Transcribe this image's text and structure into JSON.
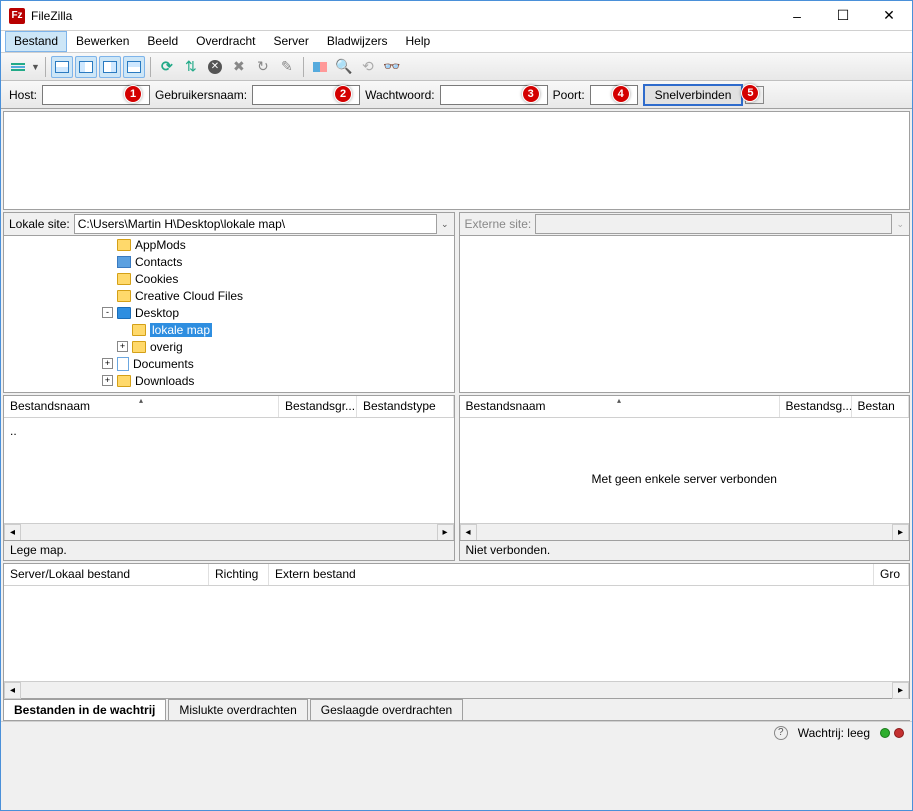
{
  "window": {
    "title": "FileZilla"
  },
  "menu": {
    "items": [
      "Bestand",
      "Bewerken",
      "Beeld",
      "Overdracht",
      "Server",
      "Bladwijzers",
      "Help"
    ]
  },
  "quick_connect": {
    "host_label": "Host:",
    "user_label": "Gebruikersnaam:",
    "pass_label": "Wachtwoord:",
    "port_label": "Poort:",
    "button_label": "Snelverbinden",
    "host_value": "",
    "user_value": "",
    "pass_value": "",
    "port_value": "",
    "markers": [
      "1",
      "2",
      "3",
      "4",
      "5"
    ]
  },
  "local": {
    "label": "Lokale site:",
    "path": "C:\\Users\\Martin H\\Desktop\\lokale map\\",
    "tree": [
      {
        "indent": 6,
        "icon": "folder",
        "label": "AppMods",
        "expand": null
      },
      {
        "indent": 6,
        "icon": "contact",
        "label": "Contacts",
        "expand": null
      },
      {
        "indent": 6,
        "icon": "folder",
        "label": "Cookies",
        "expand": null
      },
      {
        "indent": 6,
        "icon": "folder",
        "label": "Creative Cloud Files",
        "expand": null
      },
      {
        "indent": 6,
        "icon": "folder-blue",
        "label": "Desktop",
        "expand": "-"
      },
      {
        "indent": 7,
        "icon": "folder",
        "label": "lokale map",
        "selected": true,
        "expand": null
      },
      {
        "indent": 7,
        "icon": "folder",
        "label": "overig",
        "expand": "+"
      },
      {
        "indent": 6,
        "icon": "doc",
        "label": "Documents",
        "expand": "+"
      },
      {
        "indent": 6,
        "icon": "folder",
        "label": "Downloads",
        "expand": "+"
      }
    ],
    "list_cols": [
      "Bestandsnaam",
      "Bestandsgr...",
      "Bestandstype"
    ],
    "list_rows": [
      ".."
    ],
    "status": "Lege map."
  },
  "remote": {
    "label": "Externe site:",
    "path": "",
    "list_cols": [
      "Bestandsnaam",
      "Bestandsg...",
      "Bestan"
    ],
    "empty_msg": "Met geen enkele server verbonden",
    "status": "Niet verbonden."
  },
  "transfer": {
    "cols": [
      "Server/Lokaal bestand",
      "Richting",
      "Extern bestand",
      "Gro"
    ]
  },
  "tabs": {
    "items": [
      "Bestanden in de wachtrij",
      "Mislukte overdrachten",
      "Geslaagde overdrachten"
    ]
  },
  "statusbar": {
    "queue_label": "Wachtrij: leeg"
  }
}
